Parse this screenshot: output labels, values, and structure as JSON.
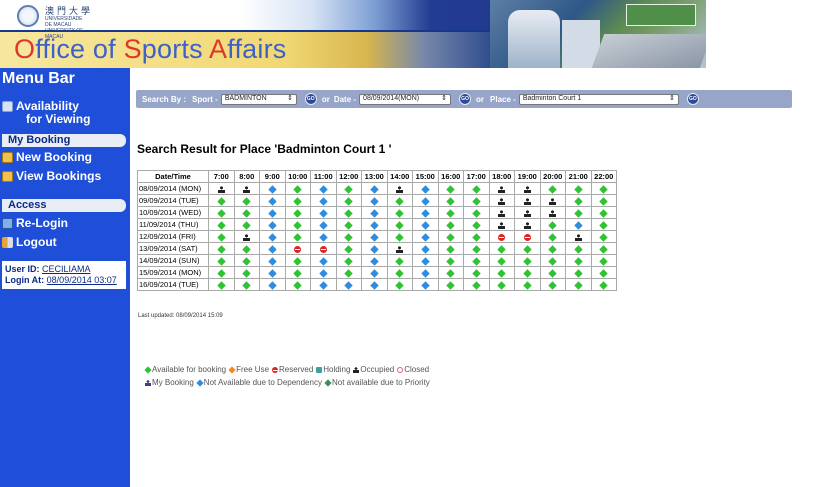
{
  "banner": {
    "university_cn": "澳門大學",
    "university_en": "UNIVERSIDADE DE MACAU UNIVERSITY OF MACAU",
    "title_parts": [
      {
        "text": "O",
        "cap": true
      },
      {
        "text": "ffice of ",
        "cap": false
      },
      {
        "text": "S",
        "cap": true
      },
      {
        "text": "ports ",
        "cap": false
      },
      {
        "text": "A",
        "cap": true
      },
      {
        "text": "ffairs",
        "cap": false
      }
    ]
  },
  "sidebar": {
    "title": "Menu Bar",
    "availability_label_1": "Availability",
    "availability_label_2": "for Viewing",
    "my_booking_header": "My Booking",
    "new_booking": "New Booking",
    "view_bookings": "View Bookings",
    "access_header": "Access",
    "relogin": "Re-Login",
    "logout": "Logout",
    "user_id_label": "User ID:",
    "user_id": "CECILIAMA",
    "login_at_label": "Login At:",
    "login_at": "08/09/2014 03:07"
  },
  "search": {
    "label": "Search By :",
    "sport_label": "Sport -",
    "sport_value": "BADMINTON",
    "or1": "or",
    "date_label": "Date -",
    "date_value": "08/09/2014(MON)",
    "or2": "or",
    "place_label": "Place -",
    "place_value": "Badminton Court 1",
    "go": "GO"
  },
  "result_title": "Search Result for Place 'Badminton Court 1 '",
  "grid": {
    "header_label": "Date/Time",
    "times": [
      "7:00",
      "8:00",
      "9:00",
      "10:00",
      "11:00",
      "12:00",
      "13:00",
      "14:00",
      "15:00",
      "16:00",
      "17:00",
      "18:00",
      "19:00",
      "20:00",
      "21:00",
      "22:00"
    ],
    "rows": [
      {
        "date": "08/09/2014 (MON)",
        "cells": [
          "occ",
          "occ",
          "nodep",
          "avail",
          "nodep",
          "avail",
          "nodep",
          "occ",
          "nodep",
          "avail",
          "avail",
          "occ",
          "occ",
          "avail",
          "avail",
          "avail"
        ]
      },
      {
        "date": "09/09/2014 (TUE)",
        "cells": [
          "avail",
          "avail",
          "nodep",
          "avail",
          "nodep",
          "avail",
          "nodep",
          "avail",
          "nodep",
          "avail",
          "avail",
          "occ",
          "occ",
          "occ",
          "avail",
          "avail"
        ]
      },
      {
        "date": "10/09/2014 (WED)",
        "cells": [
          "avail",
          "avail",
          "nodep",
          "avail",
          "nodep",
          "avail",
          "nodep",
          "avail",
          "nodep",
          "avail",
          "avail",
          "occ",
          "occ",
          "occ",
          "avail",
          "avail"
        ]
      },
      {
        "date": "11/09/2014 (THU)",
        "cells": [
          "avail",
          "avail",
          "nodep",
          "avail",
          "nodep",
          "avail",
          "nodep",
          "avail",
          "nodep",
          "avail",
          "avail",
          "occ",
          "occ",
          "avail",
          "nodep",
          "avail"
        ]
      },
      {
        "date": "12/09/2014 (FRI)",
        "cells": [
          "avail",
          "occ",
          "nodep",
          "avail",
          "nodep",
          "avail",
          "nodep",
          "avail",
          "nodep",
          "avail",
          "avail",
          "resv",
          "resv",
          "avail",
          "occ",
          "avail"
        ]
      },
      {
        "date": "13/09/2014 (SAT)",
        "cells": [
          "avail",
          "avail",
          "nodep",
          "resv",
          "resv",
          "avail",
          "nodep",
          "occ",
          "nodep",
          "avail",
          "avail",
          "avail",
          "avail",
          "avail",
          "avail",
          "avail"
        ]
      },
      {
        "date": "14/09/2014 (SUN)",
        "cells": [
          "avail",
          "avail",
          "nodep",
          "avail",
          "nodep",
          "avail",
          "nodep",
          "avail",
          "nodep",
          "avail",
          "avail",
          "avail",
          "avail",
          "avail",
          "avail",
          "avail"
        ]
      },
      {
        "date": "15/09/2014 (MON)",
        "cells": [
          "avail",
          "avail",
          "nodep",
          "avail",
          "nodep",
          "avail",
          "nodep",
          "avail",
          "nodep",
          "avail",
          "avail",
          "avail",
          "avail",
          "avail",
          "avail",
          "avail"
        ]
      },
      {
        "date": "16/09/2014 (TUE)",
        "cells": [
          "avail",
          "avail",
          "nodep",
          "avail",
          "nodep",
          "nodep",
          "nodep",
          "avail",
          "nodep",
          "avail",
          "avail",
          "avail",
          "avail",
          "avail",
          "avail",
          "avail"
        ]
      }
    ]
  },
  "last_updated": "Last updated: 08/09/2014 15:09",
  "legend": {
    "line1": [
      {
        "icon": "avail",
        "label": "Available for booking"
      },
      {
        "icon": "free",
        "label": "Free Use"
      },
      {
        "icon": "resv",
        "label": "Reserved"
      },
      {
        "icon": "hold",
        "label": "Holding"
      },
      {
        "icon": "occ",
        "label": "Occupied"
      },
      {
        "icon": "closed",
        "label": "Closed"
      }
    ],
    "line2": [
      {
        "icon": "mine",
        "label": "My Booking"
      },
      {
        "icon": "nodep",
        "label": "Not Available due to Dependency"
      },
      {
        "icon": "prio",
        "label": "Not available due to Priority"
      }
    ]
  },
  "colors": {
    "sidebar_bg": "#1f4fd8",
    "available": "#2fc233",
    "dependency": "#2e8ddf",
    "reserved": "#de2323",
    "title_blue": "#3d61c8",
    "title_red": "#e0352b"
  }
}
